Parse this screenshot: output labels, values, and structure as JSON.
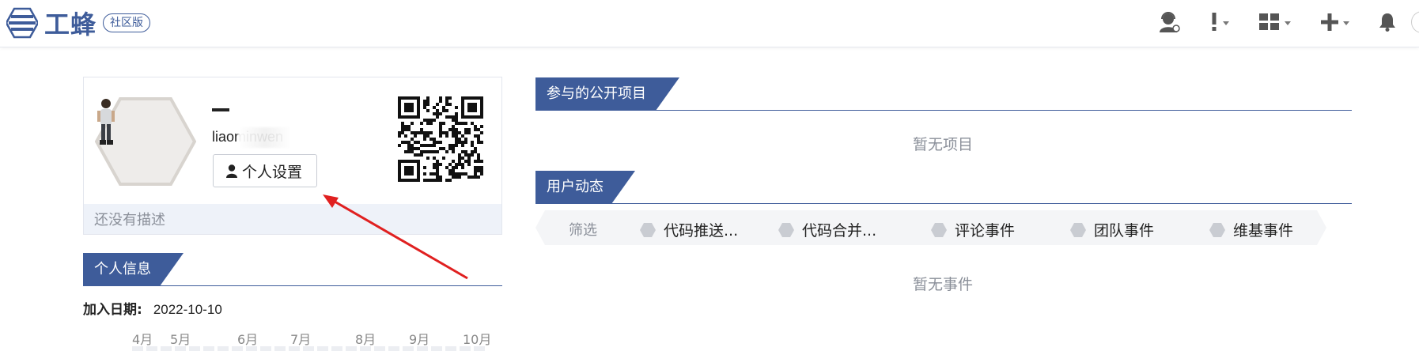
{
  "header": {
    "logo_text": "工蜂",
    "logo_badge": "社区版",
    "icons": [
      "support-agent-icon",
      "exclamation-icon",
      "apps-grid-icon",
      "plus-icon",
      "bell-icon"
    ]
  },
  "profile": {
    "username": "liaominwen",
    "settings_label": "个人设置",
    "description": "还没有描述"
  },
  "sections": {
    "personal_info": "个人信息",
    "public_projects": "参与的公开项目",
    "user_activity": "用户动态"
  },
  "personal_info": {
    "join_date_label": "加入日期:",
    "join_date_value": "2022-10-10"
  },
  "heatmap": {
    "months": [
      "4月",
      "5月",
      "6月",
      "7月",
      "8月",
      "9月",
      "10月"
    ]
  },
  "projects": {
    "empty_text": "暂无项目"
  },
  "activity": {
    "filter_label": "筛选",
    "filters": [
      "代码推送...",
      "代码合并...",
      "评论事件",
      "团队事件",
      "维基事件"
    ],
    "empty_text": "暂无事件"
  },
  "colors": {
    "brand": "#3e5c9a",
    "annotation_arrow": "#e02020"
  }
}
